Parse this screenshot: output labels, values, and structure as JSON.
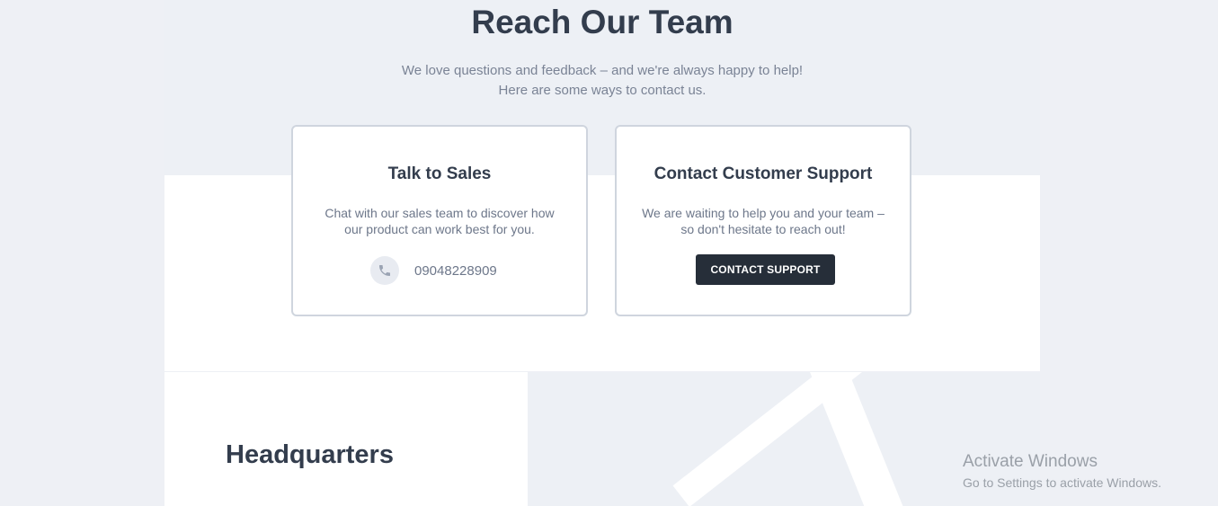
{
  "hero": {
    "title": "Reach Our Team",
    "subtitle_line1": "We love questions and feedback – and we're always happy to help!",
    "subtitle_line2": "Here are some ways to contact us."
  },
  "cards": {
    "sales": {
      "title": "Talk to Sales",
      "desc_line1": "Chat with our sales team to discover how",
      "desc_line2": "our product can work best for you.",
      "phone_icon": "phone-icon",
      "phone": "09048228909"
    },
    "support": {
      "title": "Contact Customer Support",
      "desc_line1": "We are waiting to help you and your team –",
      "desc_line2": "so don't hesitate to reach out!",
      "button_label": "CONTACT SUPPORT"
    }
  },
  "headquarters": {
    "title": "Headquarters"
  },
  "windows_watermark": {
    "title": "Activate Windows",
    "subtitle": "Go to Settings to activate Windows."
  },
  "colors": {
    "background": "#eef0f5",
    "heading": "#333d4d",
    "body_text": "#6d778a",
    "card_border": "#cfd5de",
    "button_bg": "#262e39",
    "button_text": "#ffffff"
  }
}
